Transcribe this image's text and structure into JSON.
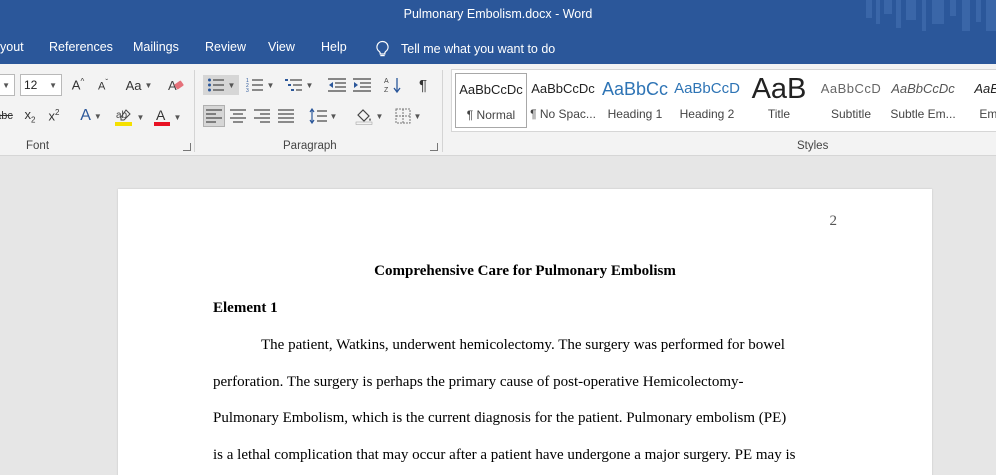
{
  "window": {
    "title": "Pulmonary Embolism.docx  -  Word"
  },
  "menu": {
    "tabs": [
      "yout",
      "References",
      "Mailings",
      "Review",
      "View",
      "Help"
    ],
    "tell_me": "Tell me what you want to do"
  },
  "ribbon": {
    "font": {
      "group_label": "Font",
      "size_value": "12",
      "change_case_label": "Aa"
    },
    "paragraph": {
      "group_label": "Paragraph"
    },
    "styles": {
      "group_label": "Styles",
      "items": [
        {
          "sample": "AaBbCcDc",
          "name": "¶ Normal",
          "selected": true
        },
        {
          "sample": "AaBbCcDc",
          "name": "¶ No Spac..."
        },
        {
          "sample": "AaBbCc",
          "name": "Heading 1"
        },
        {
          "sample": "AaBbCcD",
          "name": "Heading 2"
        },
        {
          "sample": "AaB",
          "name": "Title"
        },
        {
          "sample": "AaBbCcD",
          "name": "Subtitle"
        },
        {
          "sample": "AaBbCcDc",
          "name": "Subtle Em..."
        },
        {
          "sample": "AaBbC",
          "name": "Emph"
        }
      ]
    }
  },
  "document": {
    "page_number": "2",
    "title": "Comprehensive Care for Pulmonary Embolism",
    "heading": "Element 1",
    "lines": [
      "The patient, Watkins, underwent hemicolectomy. The surgery was performed for bowel",
      "perforation. The surgery is perhaps the primary cause of post-operative Hemicolectomy-",
      "Pulmonary Embolism, which is the current diagnosis for the patient. Pulmonary embolism (PE)",
      "is a lethal complication that may occur after a patient have undergone a major surgery. PE may is"
    ]
  },
  "colors": {
    "titlebar": "#2b579a",
    "ribbon": "#f3f3f3",
    "canvas": "#e6e6e6",
    "highlight": "#f5e000",
    "font_color": "#e81123",
    "heading_style": "#2e74b5"
  }
}
